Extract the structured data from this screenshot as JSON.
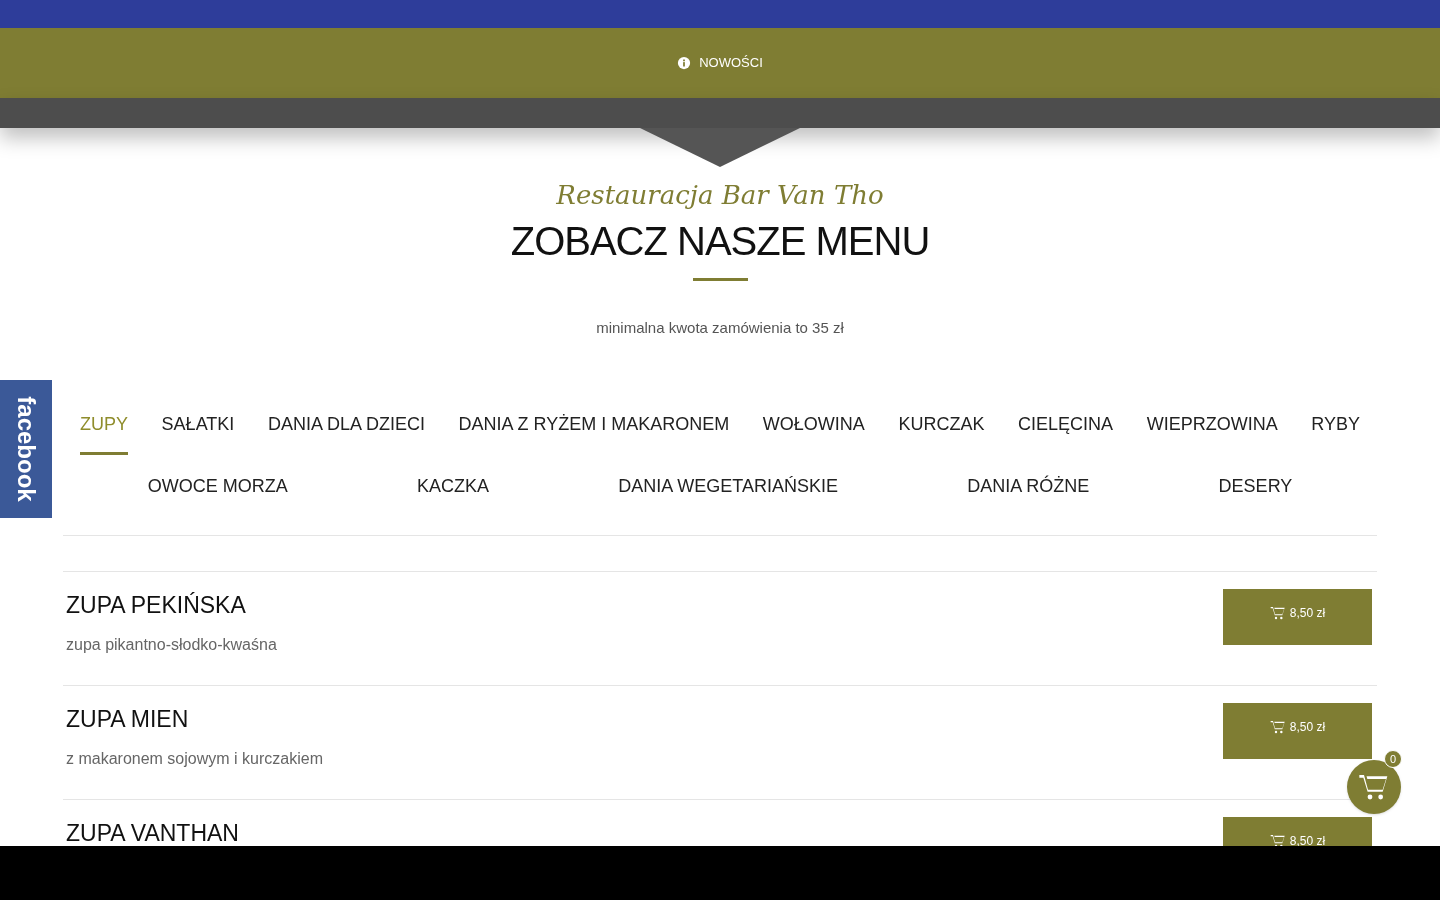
{
  "notice_bar": {
    "label": "NOWOŚCI"
  },
  "facebook_tab": {
    "label": "facebook"
  },
  "header": {
    "subtitle": "Restauracja Bar Van Tho",
    "title": "ZOBACZ NASZE MENU",
    "note": "minimalna kwota zamówienia to 35 zł"
  },
  "tab_rows": [
    {
      "tabs": [
        {
          "label": "ZUPY",
          "selected": true
        },
        {
          "label": "SAŁATKI",
          "selected": false
        },
        {
          "label": "DANIA DLA DZIECI",
          "selected": false
        },
        {
          "label": "DANIA Z RYŻEM I MAKARONEM",
          "selected": false
        },
        {
          "label": "WOŁOWINA",
          "selected": false
        },
        {
          "label": "KURCZAK",
          "selected": false
        },
        {
          "label": "CIELĘCINA",
          "selected": false
        },
        {
          "label": "WIEPRZOWINA",
          "selected": false
        },
        {
          "label": "RYBY",
          "selected": false
        }
      ]
    },
    {
      "tabs": [
        {
          "label": "OWOCE MORZA",
          "selected": false
        },
        {
          "label": "KACZKA",
          "selected": false
        },
        {
          "label": "DANIA WEGETARIAŃSKIE",
          "selected": false
        },
        {
          "label": "DANIA RÓŻNE",
          "selected": false
        },
        {
          "label": "DESERY",
          "selected": false
        }
      ]
    }
  ],
  "menu_items": [
    {
      "name": "ZUPA PEKIŃSKA",
      "description": "zupa pikantno-słodko-kwaśna",
      "price": "8,50 zł"
    },
    {
      "name": "ZUPA MIEN",
      "description": "z makaronem sojowym i kurczakiem",
      "price": "8,50 zł"
    },
    {
      "name": "ZUPA VANTHAN",
      "price": "8,50 zł"
    }
  ],
  "cart": {
    "count": "0"
  }
}
